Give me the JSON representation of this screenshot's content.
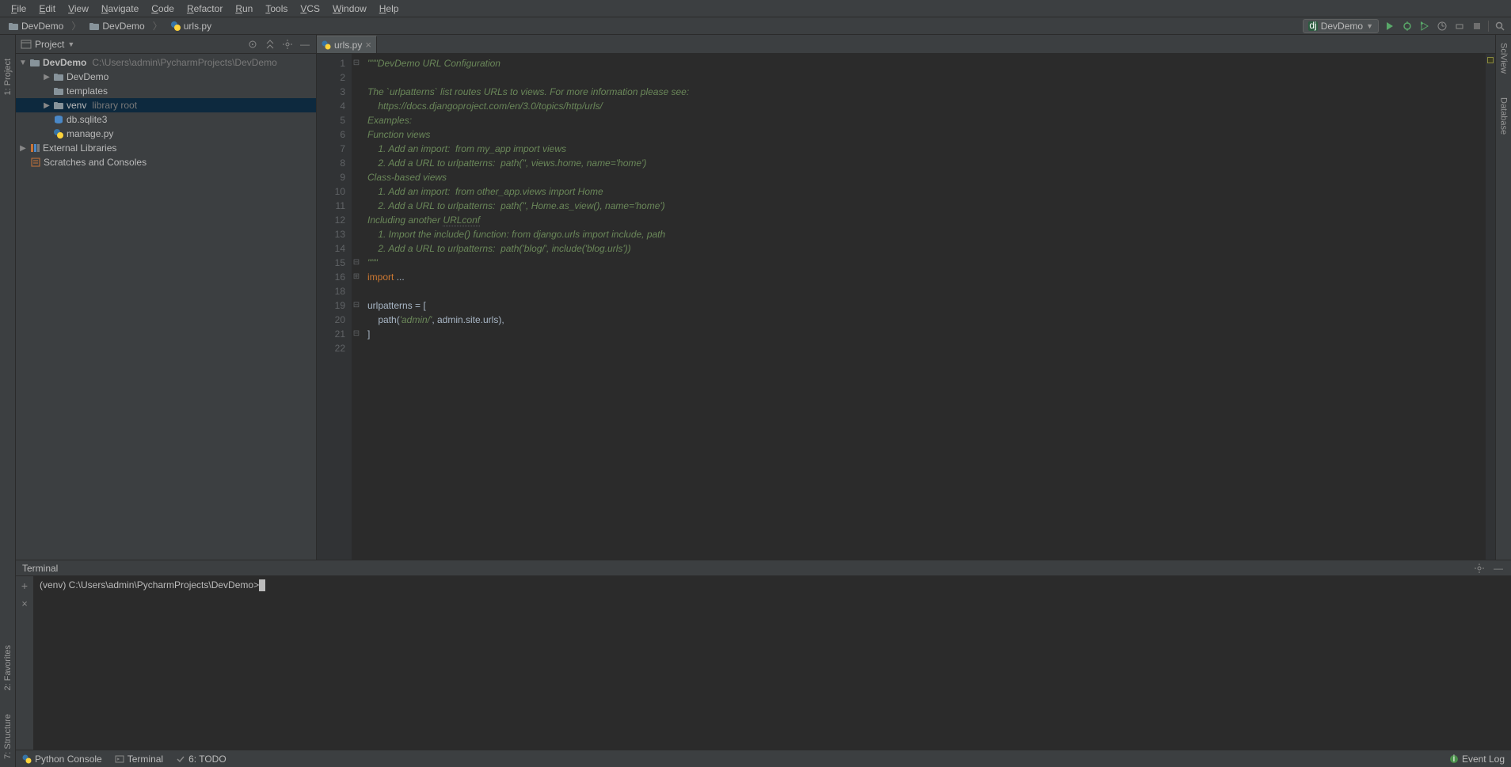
{
  "menu": [
    "File",
    "Edit",
    "View",
    "Navigate",
    "Code",
    "Refactor",
    "Run",
    "Tools",
    "VCS",
    "Window",
    "Help"
  ],
  "breadcrumb": {
    "project": "DevDemo",
    "folder": "DevDemo",
    "file": "urls.py"
  },
  "run_config": "DevDemo",
  "left_tabs": {
    "project": "1: Project",
    "favorites": "2: Favorites",
    "structure": "7: Structure"
  },
  "right_tabs": {
    "scipy": "SciView",
    "database": "Database"
  },
  "project_panel": {
    "title": "Project",
    "root": {
      "name": "DevDemo",
      "path": "C:\\Users\\admin\\PycharmProjects\\DevDemo"
    },
    "items": [
      {
        "name": "DevDemo",
        "kind": "folder",
        "indent": 2,
        "arrow": "▶"
      },
      {
        "name": "templates",
        "kind": "folder",
        "indent": 2,
        "arrow": ""
      },
      {
        "name": "venv",
        "hint": "library root",
        "kind": "folder",
        "indent": 2,
        "arrow": "▶",
        "selected": true
      },
      {
        "name": "db.sqlite3",
        "kind": "db",
        "indent": 2,
        "arrow": ""
      },
      {
        "name": "manage.py",
        "kind": "py",
        "indent": 2,
        "arrow": ""
      }
    ],
    "external": "External Libraries",
    "scratches": "Scratches and Consoles"
  },
  "editor": {
    "tab": "urls.py",
    "start_line": 1,
    "lines": [
      {
        "fold": "⊟",
        "html": "<span class='c-str'>\"\"\"DevDemo URL Configuration</span>"
      },
      {
        "fold": "",
        "html": ""
      },
      {
        "fold": "",
        "html": "<span class='c-str'>The `urlpatterns` list routes URLs to views. For more information please see:</span>"
      },
      {
        "fold": "",
        "html": "<span class='c-str'>    https://docs.djangoproject.com/en/3.0/topics/http/urls/</span>"
      },
      {
        "fold": "",
        "html": "<span class='c-str'>Examples:</span>"
      },
      {
        "fold": "",
        "html": "<span class='c-str'>Function views</span>"
      },
      {
        "fold": "",
        "html": "<span class='c-str'>    1. Add an import:  from my_app import views</span>"
      },
      {
        "fold": "",
        "html": "<span class='c-str'>    2. Add a URL to urlpatterns:  path('', views.home, name='home')</span>"
      },
      {
        "fold": "",
        "html": "<span class='c-str'>Class-based views</span>"
      },
      {
        "fold": "",
        "html": "<span class='c-str'>    1. Add an import:  from other_app.views import Home</span>"
      },
      {
        "fold": "",
        "html": "<span class='c-str'>    2. Add a URL to urlpatterns:  path('', Home.as_view(), name='home')</span>"
      },
      {
        "fold": "",
        "html": "<span class='c-str'>Including another <span class='dotted'>URLconf</span></span>"
      },
      {
        "fold": "",
        "html": "<span class='c-str'>    1. Import the include() function: from django.urls import include, path</span>"
      },
      {
        "fold": "",
        "html": "<span class='c-str'>    2. Add a URL to urlpatterns:  path('blog/', include('blog.urls'))</span>"
      },
      {
        "fold": "⊟",
        "html": "<span class='c-str'>\"\"\"</span>"
      },
      {
        "fold": "⊞",
        "html": "<span class='c-kw'>import </span><span class='c-op'>...</span>"
      },
      {
        "num": 18,
        "fold": "",
        "html": ""
      },
      {
        "num": 19,
        "fold": "⊟",
        "html": "<span class='c-txt'>urlpatterns = [</span>"
      },
      {
        "num": 20,
        "fold": "",
        "html": "    <span class='c-txt'>path(</span><span class='c-str'>'admin/'</span><span class='c-op'>, </span><span class='c-txt'>admin.site.urls),</span>"
      },
      {
        "num": 21,
        "fold": "⊟",
        "html": "<span class='c-txt'>]</span>"
      },
      {
        "num": 22,
        "fold": "",
        "html": ""
      }
    ]
  },
  "terminal": {
    "title": "Terminal",
    "prompt": "(venv) C:\\Users\\admin\\PycharmProjects\\DevDemo>"
  },
  "bottom": {
    "python_console": "Python Console",
    "terminal": "Terminal",
    "todo": "6: TODO",
    "event_log": "Event Log"
  }
}
